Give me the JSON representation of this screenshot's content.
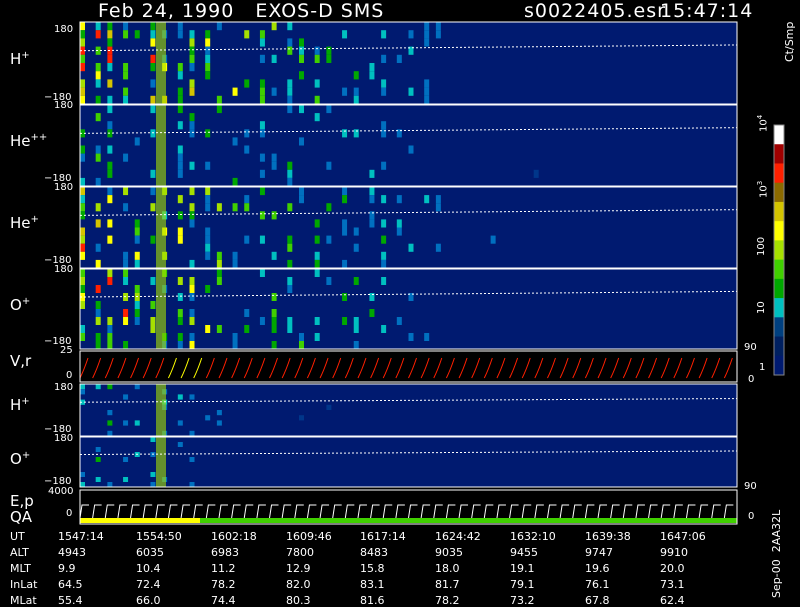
{
  "header": {
    "title_left": "Feb 24, 1990   EXOS-D SMS",
    "title_file": "s0022405.esr",
    "title_time": "15:47:14"
  },
  "panels": [
    {
      "id": "h_plus",
      "label": "H",
      "sup": "+",
      "tick_top": "180",
      "tick_bottom": "−180"
    },
    {
      "id": "he_pp",
      "label": "He",
      "sup": "++",
      "tick_top": "180",
      "tick_bottom": "−180"
    },
    {
      "id": "he_plus",
      "label": "He",
      "sup": "+",
      "tick_top": "180",
      "tick_bottom": "−180"
    },
    {
      "id": "o_plus",
      "label": "O",
      "sup": "+",
      "tick_top": "180",
      "tick_bottom": "−180"
    },
    {
      "id": "vr",
      "label": "V,r",
      "tick_top": "25",
      "tick_mid": "0",
      "right_top": "90",
      "right_bottom": "0"
    },
    {
      "id": "h_plus_2",
      "label": "H",
      "sup": "+",
      "tick_top": "180",
      "tick_bottom": "−180"
    },
    {
      "id": "o_plus_2",
      "label": "O",
      "sup": "+",
      "tick_top": "180",
      "tick_bottom": "−180",
      "right_bottom": "90"
    },
    {
      "id": "ep",
      "label": "E,p",
      "label2": "QA",
      "tick_top": "4000",
      "tick_mid": "0",
      "right_bottom": "0"
    }
  ],
  "colorbar": {
    "unit": "Ct/Smp",
    "labels": [
      {
        "t": "10",
        "sup": "4"
      },
      {
        "t": "10",
        "sup": "3"
      },
      {
        "t": "100"
      },
      {
        "t": "10"
      },
      {
        "t": "1"
      }
    ],
    "colors": [
      "#ffffff",
      "#a00000",
      "#ff2000",
      "#8b6a00",
      "#d4c400",
      "#ffff00",
      "#a6e000",
      "#40d000",
      "#00a800",
      "#00c0c0",
      "#004080",
      "#002060",
      "#001a70"
    ]
  },
  "footer_note": "Sep-00  2AA32L",
  "table": {
    "row_labels": [
      "UT",
      "ALT",
      "MLT",
      "InLat",
      "MLat"
    ],
    "columns": [
      [
        "1547:14",
        "4943",
        "9.9",
        "64.5",
        "55.4"
      ],
      [
        "1554:50",
        "6035",
        "10.4",
        "72.4",
        "66.0"
      ],
      [
        "1602:18",
        "6983",
        "11.2",
        "78.2",
        "74.4"
      ],
      [
        "1609:46",
        "7800",
        "12.9",
        "82.0",
        "80.3"
      ],
      [
        "1617:14",
        "8483",
        "15.8",
        "83.1",
        "81.6"
      ],
      [
        "1624:42",
        "9035",
        "18.0",
        "81.7",
        "78.2"
      ],
      [
        "1632:10",
        "9455",
        "19.1",
        "79.1",
        "73.2"
      ],
      [
        "1639:38",
        "9747",
        "19.6",
        "76.1",
        "67.8"
      ],
      [
        "1647:06",
        "9910",
        "20.0",
        "73.1",
        "62.4"
      ]
    ]
  },
  "chart_data": {
    "type": "heatmap",
    "title": "Feb 24, 1990   EXOS-D SMS",
    "x_time_ticks": [
      "1547:14",
      "1554:50",
      "1602:18",
      "1609:46",
      "1617:14",
      "1624:42",
      "1632:10",
      "1639:38",
      "1647:06"
    ],
    "y_range_pitch": [
      -180,
      180
    ],
    "colorbar_range_counts": [
      1,
      10000
    ],
    "colorbar_scale": "log",
    "vr_range": [
      0,
      25
    ],
    "ep_range": [
      0,
      4000
    ]
  }
}
